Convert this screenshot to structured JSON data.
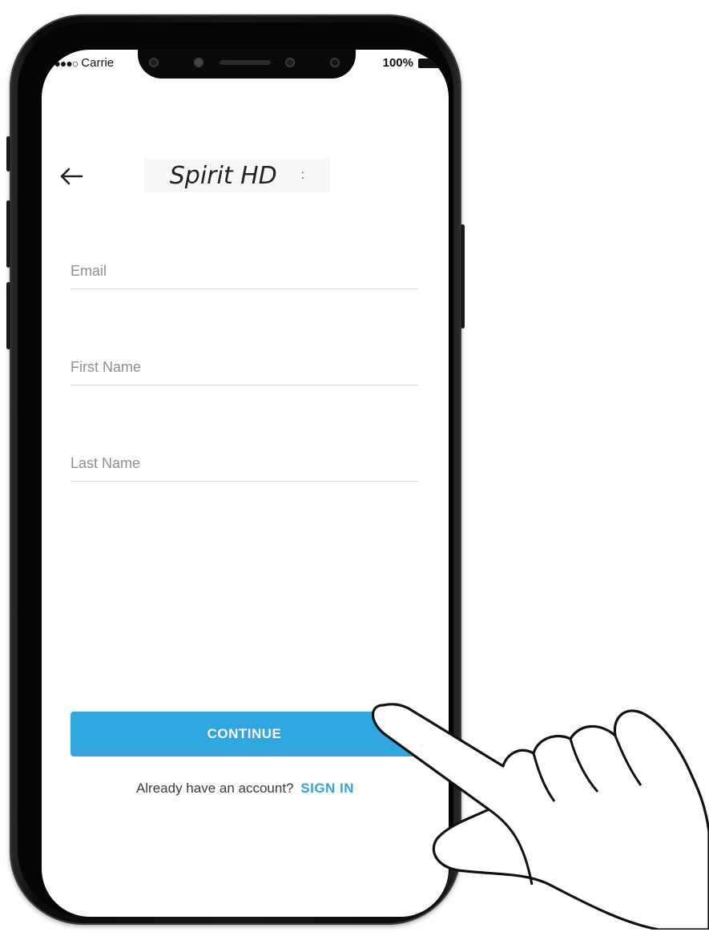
{
  "status_bar": {
    "carrier": "Carrie",
    "battery": "100%"
  },
  "header": {
    "title": "Spirit HD",
    "title_suffix": ":"
  },
  "form": {
    "email_placeholder": "Email",
    "first_name_placeholder": "First Name",
    "last_name_placeholder": "Last Name"
  },
  "actions": {
    "continue_label": "CONTINUE",
    "signin_prompt": "Already have an account?",
    "signin_label": "SIGN IN"
  },
  "colors": {
    "accent": "#2fa6df",
    "phone_body": "#111111",
    "field_underline": "#d8d8d8"
  },
  "icons": {
    "back": "arrow-left-icon",
    "overlay": "pointing-hand-icon"
  }
}
